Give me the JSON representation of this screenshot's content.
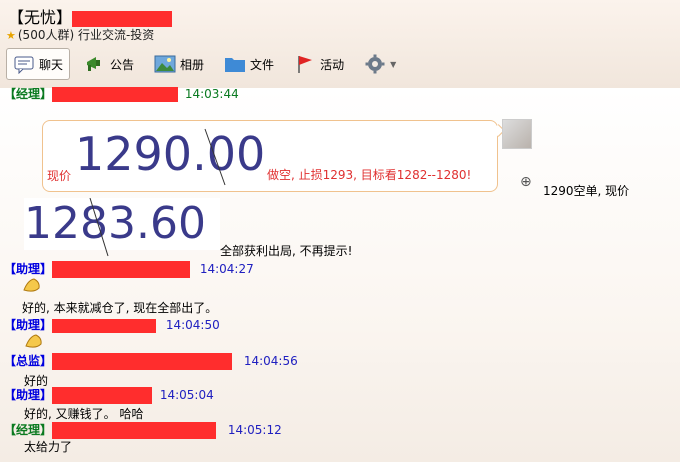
{
  "header": {
    "title": "【无忧】",
    "subtitle": "(500人群) 行业交流-投资"
  },
  "toolbar": {
    "chat": "聊天",
    "notice": "公告",
    "album": "相册",
    "files": "文件",
    "activity": "活动"
  },
  "messages": {
    "m1_role": "【经理】",
    "m1_time": "14:03:44",
    "price_now_label": "现价",
    "price_big": "1290.00",
    "advice_text": "做空, 止损1293, 目标看1282--1280!",
    "side_note": "1290空单, 现价",
    "price_big2": "1283.60",
    "all_out_text": "全部获利出局, 不再提示!",
    "m2_role": "【助理】",
    "m2_time": "14:04:27",
    "m2_text": "好的, 本来就减仓了, 现在全部出了。",
    "m3_role": "【助理】",
    "m3_time": "14:04:50",
    "m4_role": "【总监】",
    "m4_time": "14:04:56",
    "m4_text": "好的",
    "m5_role": "【助理】",
    "m5_time": "14:05:04",
    "m5_text": "好的,   又赚钱了。   哈哈",
    "m6_role": "【经理】",
    "m6_time": "14:05:12",
    "m6_text": "太给力了"
  },
  "colors": {
    "redact": "#ff2d2d",
    "timestamp": "#2020c0",
    "role": "#0000e0",
    "manager": "#0a7a20",
    "price": "#3a3a8a",
    "advice": "#e03030"
  }
}
